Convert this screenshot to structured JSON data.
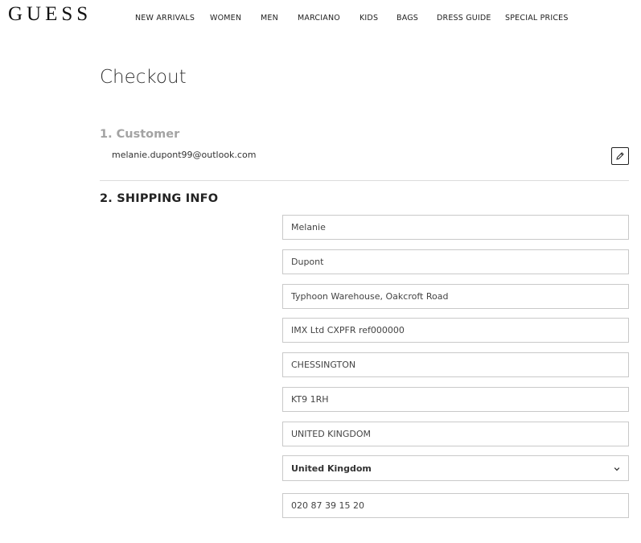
{
  "brand": {
    "logo_text": "GUESS"
  },
  "nav": {
    "items": [
      {
        "label": "NEW ARRIVALS"
      },
      {
        "label": "WOMEN"
      },
      {
        "label": "MEN"
      },
      {
        "label": "MARCIANO"
      },
      {
        "label": "KIDS"
      },
      {
        "label": "BAGS"
      },
      {
        "label": "DRESS GUIDE"
      },
      {
        "label": "SPECIAL PRICES"
      }
    ]
  },
  "checkout": {
    "title": "Checkout",
    "customer": {
      "step_title": "1. Customer",
      "email": "melanie.dupont99@outlook.com",
      "edit_icon": "pencil-icon"
    },
    "shipping": {
      "step_title": "2. SHIPPING INFO",
      "first_name": "Melanie",
      "last_name": "Dupont",
      "address_line1": "Typhoon Warehouse, Oakcroft Road",
      "address_line2": "IMX Ltd CXPFR ref000000",
      "city": "CHESSINGTON",
      "postcode": "KT9 1RH",
      "region": "UNITED KINGDOM",
      "country_selected": "United Kingdom",
      "country_icon": "chevron-down-icon",
      "phone": "020 87 39 15 20"
    }
  },
  "colors": {
    "text": "#222222",
    "muted": "#a3a3a3",
    "border": "#c9c9c9",
    "divider": "#dcdcdc",
    "background": "#ffffff"
  }
}
